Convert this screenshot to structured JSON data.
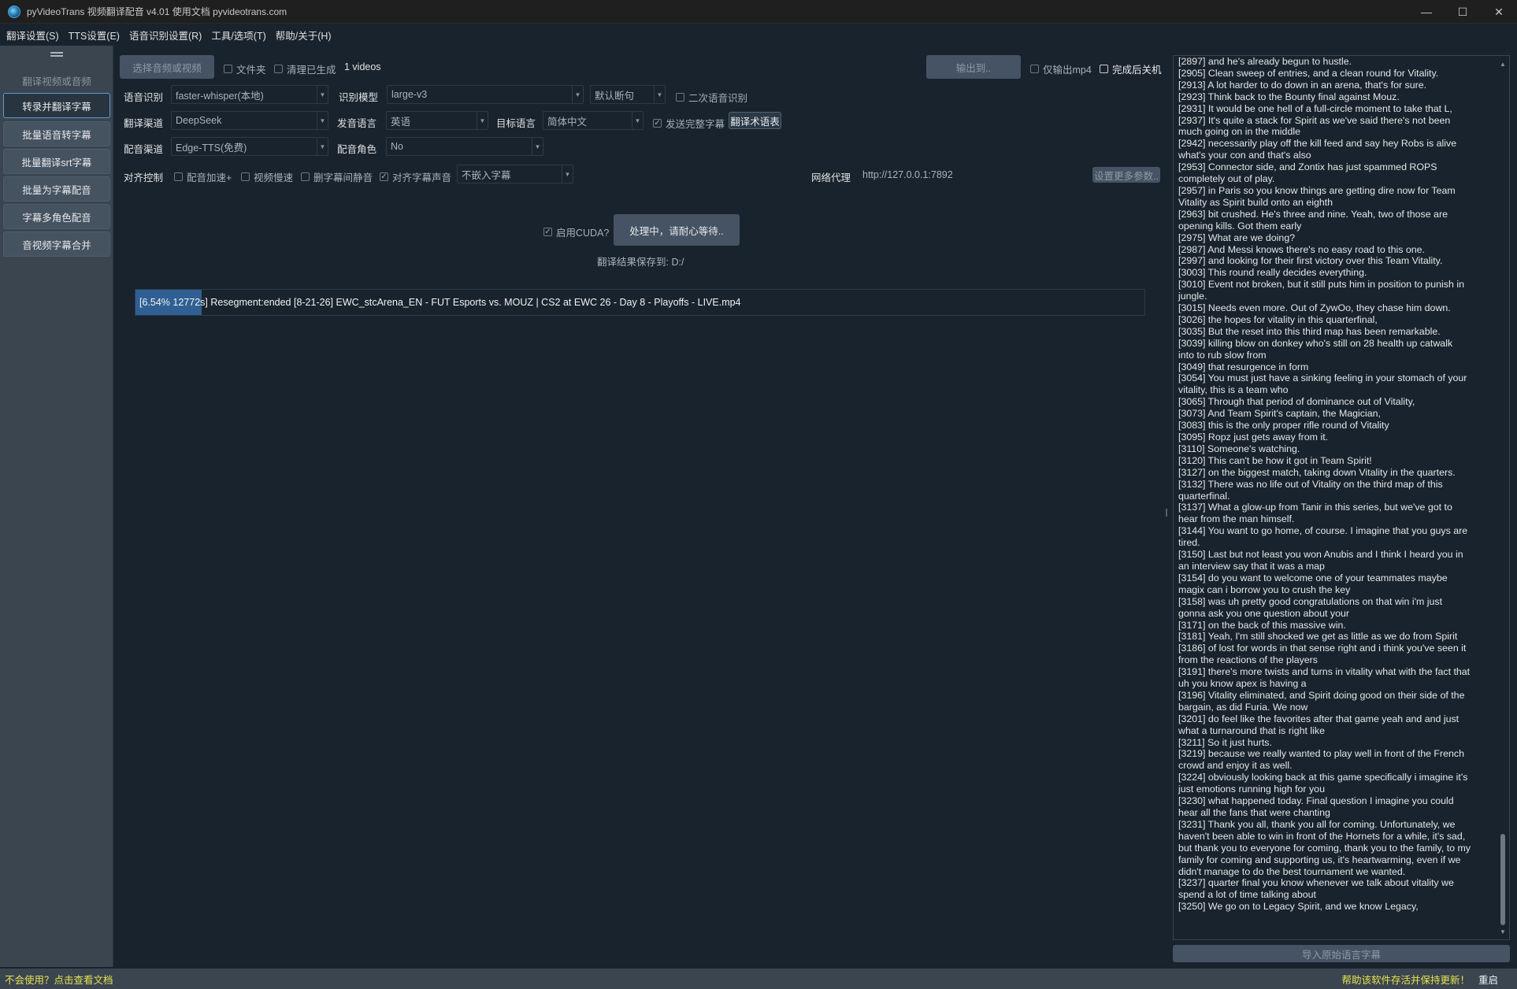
{
  "window": {
    "title": "pyVideoTrans 视频翻译配音 v4.01 使用文档 pyvideotrans.com",
    "minimize": "—",
    "maximize": "☐",
    "close": "✕"
  },
  "menu": [
    "翻译设置(S)",
    "TTS设置(E)",
    "语音识别设置(R)",
    "工具/选项(T)",
    "帮助/关于(H)"
  ],
  "sidebar": {
    "header": "翻译视频或音频",
    "items": [
      "转录并翻译字幕",
      "批量语音转字幕",
      "批量翻译srt字幕",
      "批量为字幕配音",
      "字幕多角色配音",
      "音视频字幕合并"
    ]
  },
  "toolbar": {
    "select_media": "选择音频或视频",
    "folder": "文件夹",
    "clear_generated": "清理已生成",
    "video_count": "1 videos",
    "output_to": "输出到..",
    "only_mp4": "仅输出mp4",
    "shutdown_after": "完成后关机"
  },
  "row1": {
    "asr_label": "语音识别",
    "asr_value": "faster-whisper(本地)",
    "model_label": "识别模型",
    "model_value": "large-v3",
    "split_value": "默认断句",
    "second_asr": "二次语音识别"
  },
  "row2": {
    "trans_label": "翻译渠道",
    "trans_value": "DeepSeek",
    "src_lang_label": "发音语言",
    "src_lang_value": "英语",
    "tgt_lang_label": "目标语言",
    "tgt_lang_value": "简体中文",
    "send_full": "发送完整字幕",
    "glossary": "翻译术语表"
  },
  "row3": {
    "tts_label": "配音渠道",
    "tts_value": "Edge-TTS(免费)",
    "role_label": "配音角色",
    "role_value": "No"
  },
  "row4": {
    "align_label": "对齐控制",
    "speedup": "配音加速+",
    "slow_video": "视频慢速",
    "remove_silence": "删字幕间静音",
    "align_audio": "对齐字幕声音",
    "embed_value": "不嵌入字幕",
    "proxy_label": "网络代理",
    "proxy_value": "http://127.0.0.1:7892",
    "more_params": "设置更多参数.."
  },
  "action": {
    "cuda": "启用CUDA?",
    "process": "处理中，请耐心等待..",
    "save_to": "翻译结果保存到: D:/"
  },
  "progress": {
    "percent": 6.54,
    "text": "[6.54%  12772s]  Resegment:ended [8-21-26] EWC_stcArena_EN - FUT Esports vs. MOUZ  |  CS2 at EWC 26 - Day 8 - Playoffs - LIVE.mp4"
  },
  "log": [
    "[2897]  and he's already begun to hustle.",
    "[2905]  Clean sweep of entries, and a clean round for Vitality.",
    "[2913]  A lot harder to do down in an arena, that's for sure.",
    "[2923]  Think back to the Bounty final against Mouz.",
    "[2931]  It would be one hell of a full-circle moment to take that L,",
    "[2937]  It's quite a stack for Spirit as we've said there's not been",
    "much going on in the middle",
    "[2942]  necessarily play off the kill feed and say hey Robs is alive",
    "what's your con and that's also",
    "[2953]  Connector side, and Zontix has just spammed ROPS",
    "completely out of play.",
    "[2957]  in Paris so you know things are getting dire now for Team",
    "Vitality as Spirit build onto an eighth",
    "[2963]  bit crushed. He's three and nine. Yeah, two of those are",
    "opening kills. Got them early",
    "[2975]  What are we doing?",
    "[2987]  And Messi knows there's no easy road to this one.",
    "[2997]  and looking for their first victory over this Team Vitality.",
    "[3003]  This round really decides everything.",
    "[3010]  Event not broken, but it still puts him in position to punish in",
    "jungle.",
    "[3015]  Needs even more. Out of ZywOo, they chase him down.",
    "[3026]  the hopes for vitality in this quarterfinal,",
    "[3035]  But the reset into this third map has been remarkable.",
    "[3039]  killing blow on donkey who's still on 28 health up catwalk",
    "into to rub slow from",
    "[3049]  that resurgence in form",
    "[3054]  You must just have a sinking feeling in your stomach of your",
    "vitality, this is a team who",
    "[3065]  Through that period of dominance out of Vitality,",
    "[3073]  And Team Spirit's captain, the Magician,",
    "[3083]  this is the only proper rifle round of Vitality",
    "[3095]  Ropz just gets away from it.",
    "[3110]  Someone's watching.",
    "[3120]  This can't be how it got in Team Spirit!",
    "[3127]  on the biggest match, taking down Vitality in the quarters.",
    "[3132]  There was no life out of Vitality on the third map of this",
    "quarterfinal.",
    "[3137]  What a glow-up from Tanir in this series, but we've got to",
    "hear from the man himself.",
    "[3144]  You want to go home, of course. I imagine that you guys are",
    "tired.",
    "[3150]  Last but not least you won Anubis and I think I heard you in",
    "an interview say that it was a map",
    "[3154]  do you want to welcome one of your teammates maybe",
    "magix can i borrow you to crush the key",
    "[3158]  was uh pretty good congratulations on that win i'm just",
    "gonna ask you one question about your",
    "[3171]  on the back of this massive win.",
    "[3181]  Yeah, I'm still shocked we get as little as we do from Spirit",
    "[3186]  of lost for words in that sense right and i think you've seen it",
    "from the reactions of the players",
    "[3191]  there's more twists and turns in vitality what with the fact that",
    "uh you know apex is having a",
    "[3196]  Vitality eliminated, and Spirit doing good on their side of the",
    "bargain, as did Furia. We now",
    "[3201]  do feel like the favorites after that game yeah and and just",
    "what a turnaround that is right like",
    "[3211]  So it just hurts.",
    "[3219]  because we really wanted to play well in front of the French",
    "crowd and enjoy it as well.",
    "[3224]  obviously looking back at this game specifically i imagine it's",
    "just emotions running high for you",
    "[3230]  what happened today. Final question I imagine you could",
    "hear all the fans that were chanting",
    "[3231]  Thank you all, thank you all for coming. Unfortunately, we",
    "haven't been able to win in front of the Hornets for a while, it's sad,",
    "but thank you to everyone for coming, thank you to the family, to my",
    "family for coming and supporting us, it's heartwarming, even if we",
    "didn't manage to do the best tournament we wanted.",
    "[3237]  quarter final you know whenever we talk about vitality we",
    "spend a lot of time talking about",
    "[3250]  We go on to Legacy Spirit, and we know Legacy,"
  ],
  "import_btn": "导入原始语言字幕",
  "status": {
    "help": "不会使用？点击查看文档",
    "support": "帮助该软件存活并保持更新！",
    "restart": "重启"
  }
}
